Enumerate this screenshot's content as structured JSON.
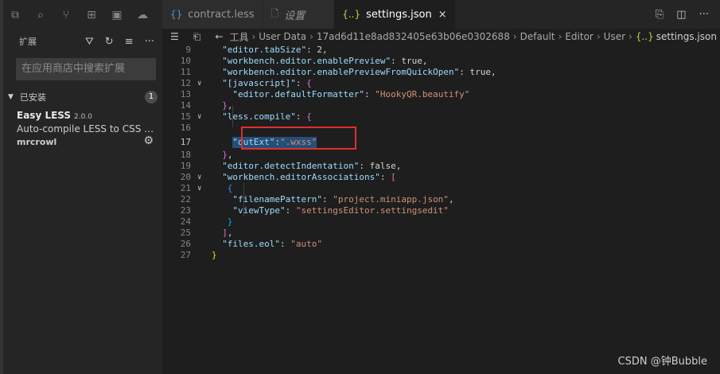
{
  "sidebar": {
    "view_title": "扩展",
    "search_placeholder": "在应用商店中搜索扩展",
    "section_label": "已安装",
    "section_count": "1",
    "extension": {
      "name": "Easy LESS",
      "version": "2.0.0",
      "description": "Auto-compile LESS to CSS o...",
      "publisher": "mrcrowl"
    }
  },
  "tabs": [
    {
      "label": "contract.less",
      "icon": "{}"
    },
    {
      "label": "设置",
      "icon": "file-icon"
    },
    {
      "label": "settings.json",
      "icon": "{..}",
      "close": "×"
    }
  ],
  "breadcrumb": [
    "工具",
    "User Data",
    "17ad6d11e8ad832405e63b06e0302688",
    "Default",
    "Editor",
    "User",
    "settings.json"
  ],
  "code_lines": [
    {
      "n": "9",
      "text": "\"editor.tabSize\": 2,"
    },
    {
      "n": "10",
      "text": "\"workbench.editor.enablePreview\": true,"
    },
    {
      "n": "11",
      "text": "\"workbench.editor.enablePreviewFromQuickOpen\": true,"
    },
    {
      "n": "12",
      "text": "\"[javascript]\": {"
    },
    {
      "n": "13",
      "text": "\"editor.defaultFormatter\": \"HookyQR.beautify\""
    },
    {
      "n": "14",
      "text": "},"
    },
    {
      "n": "15",
      "text": "\"less.compile\": {"
    },
    {
      "n": "16",
      "text": ""
    },
    {
      "n": "17",
      "text": "\"outExt\":\".wxss\""
    },
    {
      "n": "18",
      "text": "},"
    },
    {
      "n": "19",
      "text": "\"editor.detectIndentation\": false,"
    },
    {
      "n": "20",
      "text": "\"workbench.editorAssociations\": ["
    },
    {
      "n": "21",
      "text": "{"
    },
    {
      "n": "22",
      "text": "\"filenamePattern\": \"project.miniapp.json\","
    },
    {
      "n": "23",
      "text": "\"viewType\": \"settingsEditor.settingsedit\""
    },
    {
      "n": "24",
      "text": "}"
    },
    {
      "n": "25",
      "text": "],"
    },
    {
      "n": "26",
      "text": "\"files.eol\": \"auto\""
    },
    {
      "n": "27",
      "text": "}"
    }
  ],
  "watermark": "CSDN @钟Bubble",
  "colors": {
    "highlight_box": "#e0302a",
    "selection": "#264f78"
  }
}
